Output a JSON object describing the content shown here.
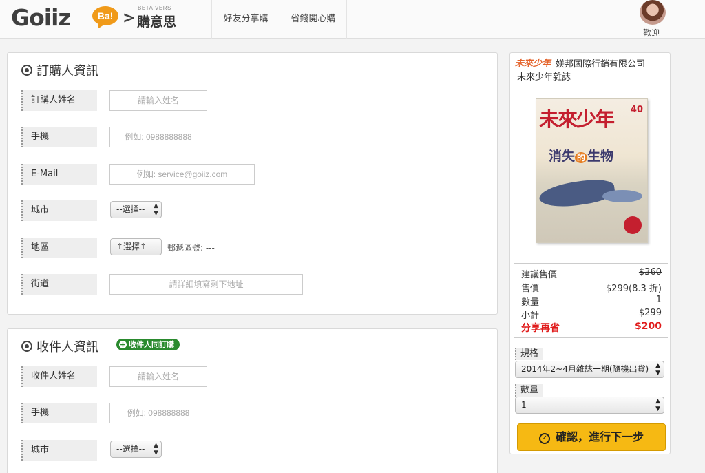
{
  "header": {
    "logo": "Goiiz",
    "logo_bubble": "Ba!",
    "logo_arrow": ">",
    "beta": "BETA.VERS",
    "brand_sub": "購意思",
    "nav": [
      "好友分享購",
      "省錢開心購"
    ],
    "welcome": "歡迎"
  },
  "buyer": {
    "title": "訂購人資訊",
    "name_label": "訂購人姓名",
    "name_placeholder": "請輸入姓名",
    "phone_label": "手機",
    "phone_placeholder": "例如: 0988888888",
    "email_label": "E-Mail",
    "email_placeholder": "例如: service@goiiz.com",
    "city_label": "城市",
    "city_value": "--選擇--",
    "district_label": "地區",
    "district_value": "↑選擇↑",
    "zip_text": "郵遞區號: ---",
    "street_label": "街道",
    "street_placeholder": "請詳細填寫剩下地址"
  },
  "receiver": {
    "title": "收件人資訊",
    "same_badge": "收件人同訂購",
    "same_badge_icon": "+",
    "name_label": "收件人姓名",
    "name_placeholder": "請輸入姓名",
    "phone_label": "手機",
    "phone_placeholder": "例如: 098888888",
    "city_label": "城市",
    "city_value": "--選擇--"
  },
  "side": {
    "brand_logo": "未來少年",
    "vendor": "媄邦國際行銷有限公司",
    "product": "未來少年雜誌",
    "cover": {
      "title": "未來少年",
      "issue": "40",
      "headline_a": "消失",
      "headline_de": "的",
      "headline_b": "生物"
    },
    "prices": [
      {
        "label": "建議售價",
        "value": "$360"
      },
      {
        "label": "售價",
        "value": "$299(8.3 折)"
      },
      {
        "label": "數量",
        "value": "1"
      },
      {
        "label": "小計",
        "value": "$299"
      },
      {
        "label": "分享再省",
        "value": "$200"
      }
    ],
    "spec_label": "規格",
    "spec_value": "2014年2~4月雜誌一期(隨機出貨)",
    "qty_label": "數量",
    "qty_value": "1",
    "confirm": "確認，進行下一步",
    "confirm_icon": "✓"
  },
  "colors": {
    "accent_orange": "#f09a19",
    "confirm_yellow": "#f6b913",
    "badge_green": "#2a8a2e",
    "save_red": "#e01b1b"
  }
}
